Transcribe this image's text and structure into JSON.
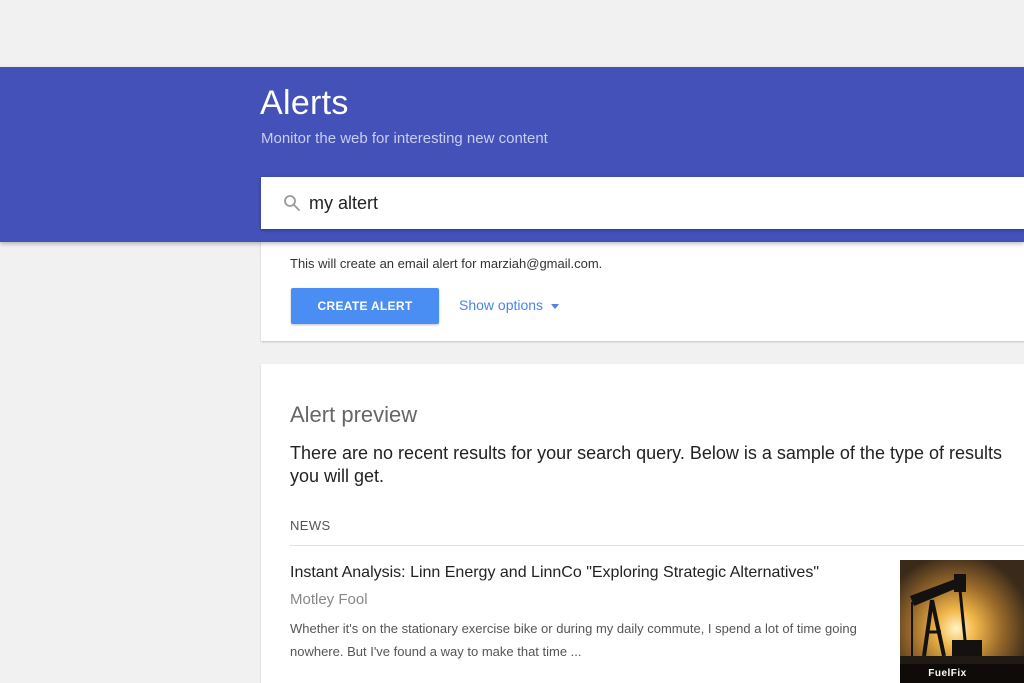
{
  "header": {
    "title": "Alerts",
    "subtitle": "Monitor the web for interesting new content",
    "background_color": "#4351b9"
  },
  "search": {
    "value": "my altert",
    "icon": "search-icon"
  },
  "create_card": {
    "note": "This will create an email alert for marziah@gmail.com.",
    "create_button_label": "CREATE ALERT",
    "show_options_label": "Show options",
    "button_color": "#4a8ef3",
    "link_color": "#4a84e8"
  },
  "preview": {
    "title": "Alert preview",
    "description": "There are no recent results for your search query. Below is a sample of the type of results you will get.",
    "section_label": "NEWS",
    "news_item": {
      "title": "Instant Analysis: Linn Energy and LinnCo \"Exploring Strategic Alternatives\"",
      "source": "Motley Fool",
      "snippet": "Whether it's on the stationary exercise bike or during my daily commute, I spend a lot of time going nowhere. But I've found a way to make that time ...",
      "thumbnail_caption": "FuelFix"
    }
  }
}
